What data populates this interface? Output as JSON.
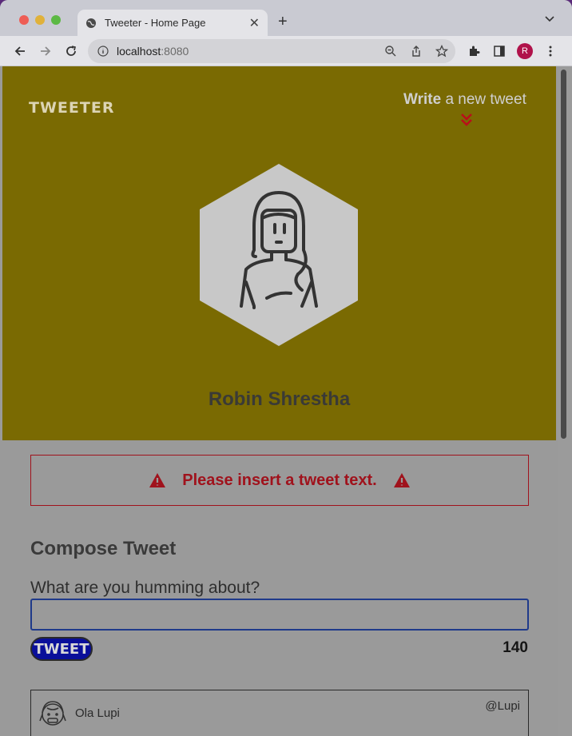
{
  "browser": {
    "tab_title": "Tweeter - Home Page",
    "url_host": "localhost",
    "url_port": ":8080",
    "profile_initial": "R"
  },
  "header": {
    "logo": "TWEETER",
    "write_bold": "Write",
    "write_rest": " a new tweet",
    "user_name": "Robin Shrestha"
  },
  "error": {
    "message": "Please insert a tweet text."
  },
  "compose": {
    "title": "Compose Tweet",
    "prompt": "What are you humming about?",
    "input_value": "",
    "button_label": "TWEET",
    "counter": "140"
  },
  "tweets": [
    {
      "author": "Ola Lupi",
      "handle": "@Lupi"
    }
  ],
  "colors": {
    "header_bg": "#7a6a02",
    "error": "#a0121c",
    "button_bg": "#0a0f9a"
  }
}
